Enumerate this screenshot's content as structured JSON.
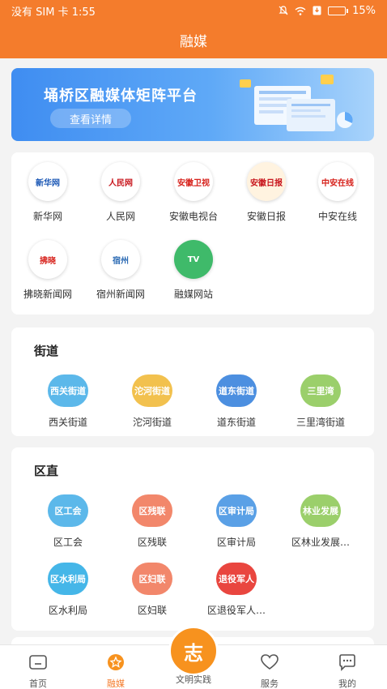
{
  "status_bar": {
    "carrier_time": "没有 SIM 卡 1:55",
    "battery": "15%"
  },
  "header": {
    "title": "融媒"
  },
  "banner": {
    "title": "埇桥区融媒体矩阵平台",
    "button": "查看详情"
  },
  "media": [
    {
      "label": "新华网",
      "logo_text": "新华网",
      "color": "#1a57b5"
    },
    {
      "label": "人民网",
      "logo_text": "人民网",
      "color": "#c8161d"
    },
    {
      "label": "安徽电视台",
      "logo_text": "安徽卫视",
      "color": "#d7231d"
    },
    {
      "label": "安徽日报",
      "logo_text": "安徽日报",
      "color": "#c8161d"
    },
    {
      "label": "中安在线",
      "logo_text": "中安在线",
      "color": "#d7231d"
    },
    {
      "label": "拂晓新闻网",
      "logo_text": "拂晓",
      "color": "#d7231d"
    },
    {
      "label": "宿州新闻网",
      "logo_text": "宿州",
      "color": "#2f6db5"
    },
    {
      "label": "融媒网站",
      "logo_text": "TV",
      "color": "#3fba6a"
    }
  ],
  "street": {
    "title": "街道",
    "items": [
      {
        "icon_text": "西关街道",
        "label": "西关街道",
        "color": "#5cb8ea"
      },
      {
        "icon_text": "沱河街道",
        "label": "沱河街道",
        "color": "#f2c14e"
      },
      {
        "icon_text": "道东街道",
        "label": "道东街道",
        "color": "#4c8fe0"
      },
      {
        "icon_text": "三里湾",
        "label": "三里湾街道",
        "color": "#9bcf6b"
      }
    ]
  },
  "district": {
    "title": "区直",
    "items": [
      {
        "icon_text": "区工会",
        "label": "区工会",
        "color": "#5cb8ea"
      },
      {
        "icon_text": "区残联",
        "label": "区残联",
        "color": "#f2876b"
      },
      {
        "icon_text": "区审计局",
        "label": "区审计局",
        "color": "#5aa0e6"
      },
      {
        "icon_text": "林业发展",
        "label": "区林业发展…",
        "color": "#9bcf6b"
      },
      {
        "icon_text": "区水利局",
        "label": "区水利局",
        "color": "#45b6e8"
      },
      {
        "icon_text": "区妇联",
        "label": "区妇联",
        "color": "#f2876b"
      },
      {
        "icon_text": "退役军人",
        "label": "区退役军人…",
        "color": "#e9463f"
      }
    ]
  },
  "tabbar": {
    "home": "首页",
    "media": "融媒",
    "center_icon": "志",
    "practice": "文明实践",
    "service": "服务",
    "mine": "我的",
    "active_color": "#f47c2c"
  }
}
